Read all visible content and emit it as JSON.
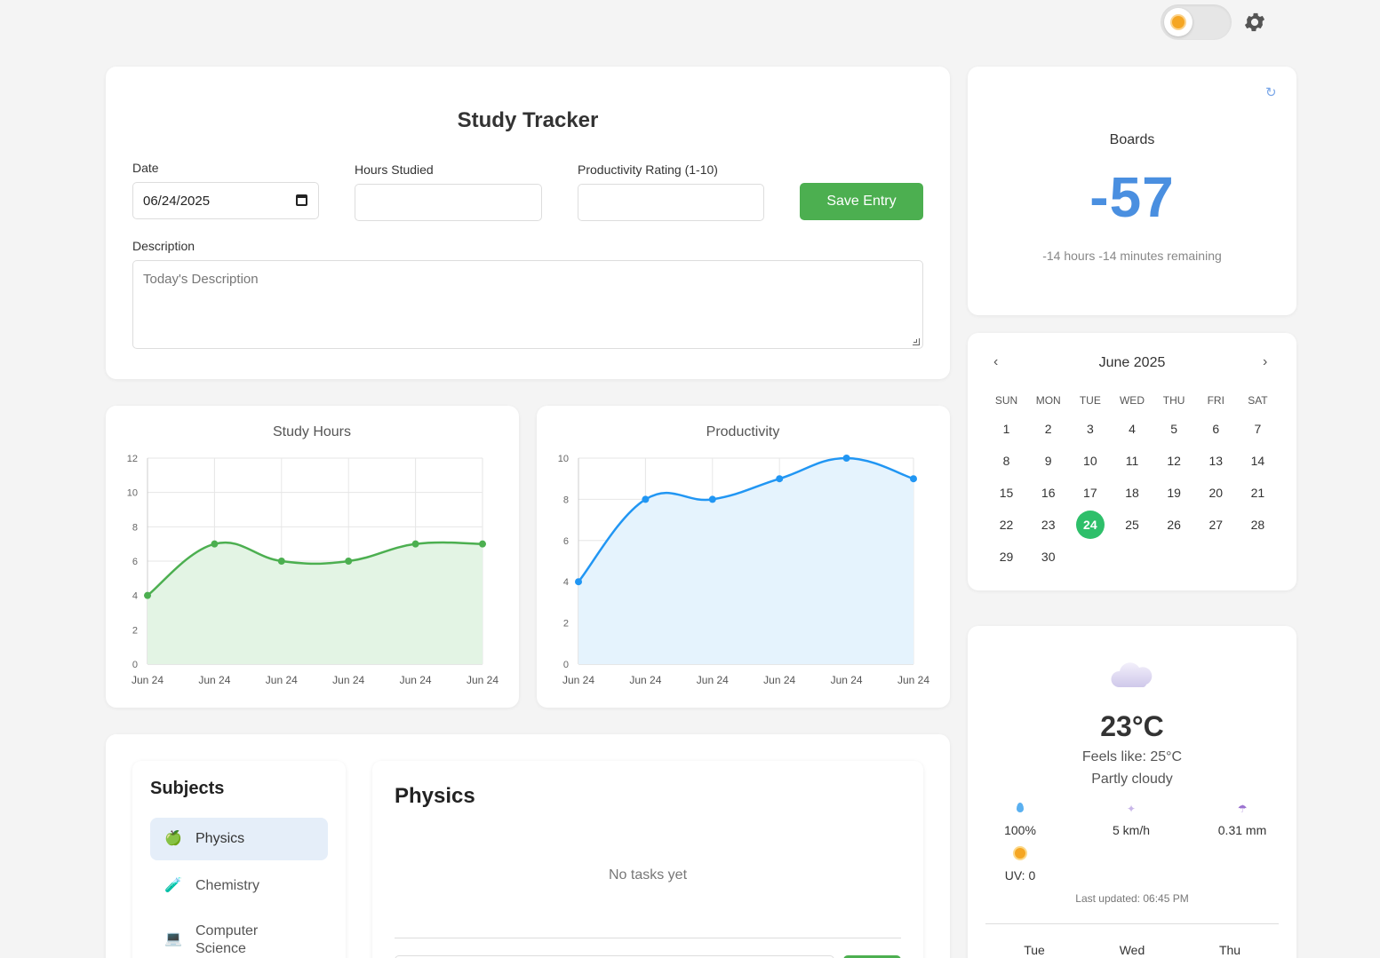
{
  "header": {
    "theme_icon": "sun-icon",
    "settings_icon": "gear-icon"
  },
  "tracker": {
    "title": "Study Tracker",
    "date_label": "Date",
    "date_value": "06/24/2025",
    "hours_label": "Hours Studied",
    "hours_value": "",
    "productivity_label": "Productivity Rating (1-10)",
    "productivity_value": "",
    "save_label": "Save Entry",
    "description_label": "Description",
    "description_placeholder": "Today's Description"
  },
  "chart_data": [
    {
      "type": "area",
      "title": "Study Hours",
      "categories": [
        "Jun 24",
        "Jun 24",
        "Jun 24",
        "Jun 24",
        "Jun 24",
        "Jun 24"
      ],
      "values": [
        4,
        7,
        6,
        6,
        7,
        7
      ],
      "ylim": [
        0,
        12
      ],
      "yticks": [
        0,
        2,
        4,
        6,
        8,
        10,
        12
      ],
      "color": "#4caf50",
      "fill": "#e3f4e4",
      "grid": true
    },
    {
      "type": "area",
      "title": "Productivity",
      "categories": [
        "Jun 24",
        "Jun 24",
        "Jun 24",
        "Jun 24",
        "Jun 24",
        "Jun 24"
      ],
      "values": [
        4,
        8,
        8,
        9,
        10,
        9
      ],
      "ylim": [
        0,
        10
      ],
      "yticks": [
        0,
        2,
        4,
        6,
        8,
        10
      ],
      "color": "#2196f3",
      "fill": "#e5f3fd",
      "grid": true
    }
  ],
  "subjects": {
    "title": "Subjects",
    "items": [
      {
        "label": "Physics",
        "icon": "🍏",
        "active": true
      },
      {
        "label": "Chemistry",
        "icon": "🧪",
        "active": false
      },
      {
        "label": "Computer Science",
        "icon": "💻",
        "active": false
      }
    ]
  },
  "physics": {
    "title": "Physics",
    "empty_text": "No tasks yet"
  },
  "boards": {
    "refresh_icon": "↻",
    "title": "Boards",
    "count": "-57",
    "remaining": "-14 hours -14 minutes remaining"
  },
  "calendar": {
    "month": "June 2025",
    "prev": "‹",
    "next": "›",
    "weekdays": [
      "SUN",
      "MON",
      "TUE",
      "WED",
      "THU",
      "FRI",
      "SAT"
    ],
    "start_offset": 0,
    "days_in_month": 30,
    "today": 24
  },
  "weather": {
    "temp": "23°C",
    "feels_like": "Feels like: 25°C",
    "description": "Partly cloudy",
    "humidity": "100%",
    "wind": "5 km/h",
    "precipitation": "0.31 mm",
    "uv": "UV: 0",
    "updated": "Last updated: 06:45 PM",
    "forecast_days": [
      "Tue",
      "Wed",
      "Thu"
    ]
  }
}
